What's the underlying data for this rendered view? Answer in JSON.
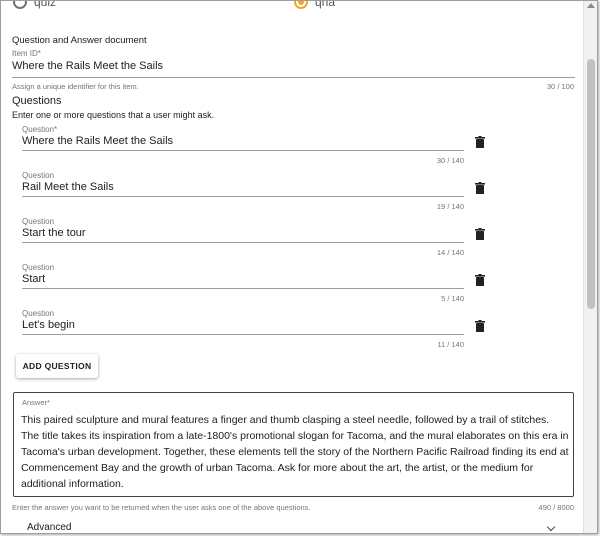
{
  "type_options": [
    {
      "label": "quiz",
      "selected": false
    },
    {
      "label": "qna",
      "selected": true
    }
  ],
  "section_title": "Question and Answer document",
  "item_id": {
    "label": "Item ID*",
    "value": "Where the Rails Meet the Sails",
    "helper": "Assign a unique identifier for this item.",
    "counter": "30 / 100"
  },
  "questions_section": {
    "heading": "Questions",
    "subtext": "Enter one or more questions that a user might ask.",
    "items": [
      {
        "label": "Question*",
        "value": "Where the Rails Meet the Sails",
        "counter": "30 / 140"
      },
      {
        "label": "Question",
        "value": "Rail Meet the Sails",
        "counter": "19 / 140"
      },
      {
        "label": "Question",
        "value": "Start the tour",
        "counter": "14 / 140"
      },
      {
        "label": "Question",
        "value": "Start",
        "counter": "5 / 140"
      },
      {
        "label": "Question",
        "value": "Let's begin",
        "counter": "11 / 140"
      }
    ],
    "add_button": "ADD QUESTION"
  },
  "answer": {
    "label": "Answer*",
    "value": "This paired sculpture and mural features a finger and thumb clasping a steel needle, followed by a trail of stitches. The title takes its inspiration from a late-1800's promotional slogan for Tacoma, and the mural elaborates on this era in Tacoma's urban development. Together, these elements tell the story of the Northern Pacific Railroad finding its end at Commencement Bay and the growth of urban Tacoma. Ask for more about the art, the artist, or the medium for additional information.",
    "helper": "Enter the answer you want to be returned when the user asks one of the above questions.",
    "counter": "490 / 8000"
  },
  "advanced_label": "Advanced",
  "icons": {
    "delete": "trash-icon",
    "expand": "chevron-down-icon"
  },
  "colors": {
    "radio_selected": "#f5a623",
    "text": "#212121",
    "muted": "#757575"
  }
}
